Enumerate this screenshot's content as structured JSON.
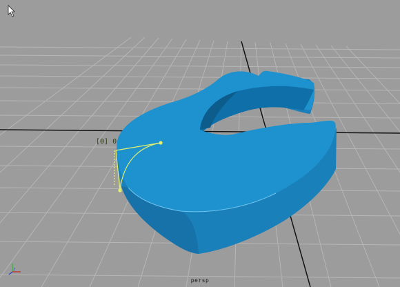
{
  "viewport": {
    "camera_label": "persp",
    "background": "#9c9c9c",
    "grid_color": "#b4b4b4",
    "axis_color": "#111111"
  },
  "object": {
    "shape": "extruded crescent / horseshoe solid",
    "color_top": "#1e91cf",
    "color_side": "#1a7fb8",
    "color_dark": "#0e5f8f"
  },
  "curve": {
    "component_label": "[0] 0",
    "color": "#e7f07a"
  },
  "icons": {
    "cursor": "arrow-cursor-icon",
    "axis_gizmo": "axis-gizmo-icon"
  }
}
